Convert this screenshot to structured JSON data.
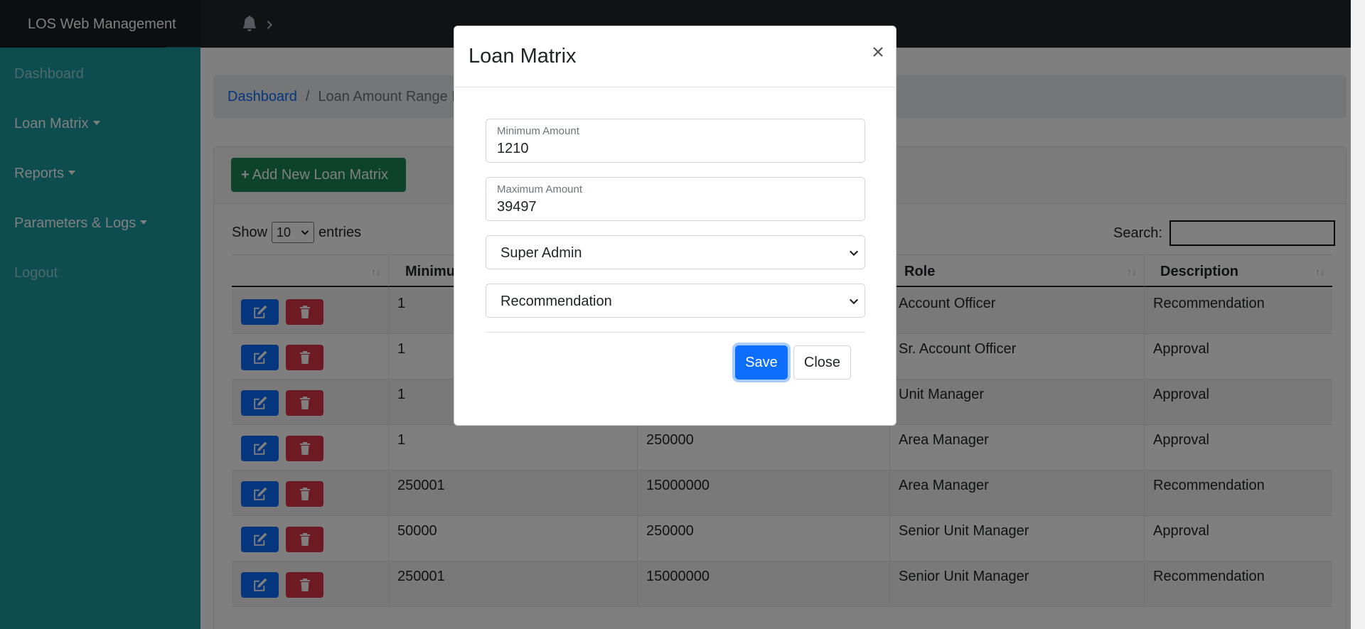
{
  "app": {
    "title": "LOS Web Management"
  },
  "topnav": {
    "bell_icon": "bell-icon",
    "chevron_icon": "chevron-right-icon"
  },
  "sidebar": {
    "items": [
      {
        "label": "Dashboard",
        "muted": true
      },
      {
        "label": "Loan Matrix",
        "dropdown": true
      },
      {
        "label": "Reports",
        "dropdown": true
      },
      {
        "label": "Parameters & Logs",
        "dropdown": true
      },
      {
        "label": "Logout",
        "muted": true
      }
    ]
  },
  "breadcrumb": {
    "home": "Dashboard",
    "separator": "/",
    "current": "Loan Amount Range M"
  },
  "toolbar": {
    "add_label": "Add New Loan Matrix",
    "add_icon": "plus-icon"
  },
  "table_controls": {
    "show_prefix": "Show",
    "entries_value": "10",
    "show_suffix": "entries",
    "search_label": "Search:"
  },
  "table": {
    "columns": [
      "",
      "Minimu",
      "",
      "Role",
      "Description"
    ],
    "rows": [
      {
        "min": "1",
        "max": "",
        "role": "Account Officer",
        "description": "Recommendation"
      },
      {
        "min": "1",
        "max": "",
        "role": "Sr. Account Officer",
        "description": "Approval"
      },
      {
        "min": "1",
        "max": "",
        "role": "Unit Manager",
        "description": "Approval"
      },
      {
        "min": "1",
        "max": "250000",
        "role": "Area Manager",
        "description": "Approval"
      },
      {
        "min": "250001",
        "max": "15000000",
        "role": "Area Manager",
        "description": "Recommendation"
      },
      {
        "min": "50000",
        "max": "250000",
        "role": "Senior Unit Manager",
        "description": "Approval"
      },
      {
        "min": "250001",
        "max": "15000000",
        "role": "Senior Unit Manager",
        "description": "Recommendation"
      }
    ]
  },
  "modal": {
    "title": "Loan Matrix",
    "close_glyph": "×",
    "min_label": "Minimum Amount",
    "min_value": "1210",
    "max_label": "Maximum Amount",
    "max_value": "39497",
    "role_selected": "Super Admin",
    "type_selected": "Recommendation",
    "save_label": "Save",
    "close_label": "Close"
  },
  "colors": {
    "sidebar": "#1a9ba1",
    "topnav": "#212529",
    "primary": "#0d6efd",
    "danger": "#dc3545",
    "success": "#198754"
  }
}
